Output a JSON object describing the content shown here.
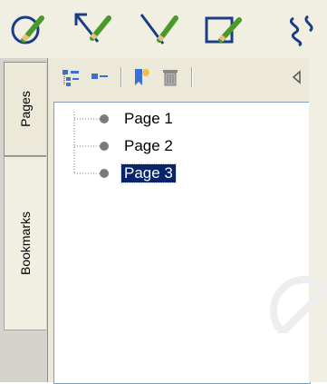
{
  "toolbar": {
    "tools": [
      {
        "icon": "ellipse-pencil-icon"
      },
      {
        "icon": "arrow-pencil-icon"
      },
      {
        "icon": "line-pencil-icon"
      },
      {
        "icon": "rectangle-pencil-icon"
      },
      {
        "icon": "freehand-pencil-icon"
      }
    ]
  },
  "side_tabs": [
    {
      "label": "Pages",
      "active": true
    },
    {
      "label": "Bookmarks",
      "active": false
    }
  ],
  "panel_toolbar": {
    "buttons": [
      "expand-all-icon",
      "collapse-all-icon",
      "new-bookmark-icon",
      "delete-icon",
      "collapse-panel-icon"
    ]
  },
  "pages": [
    {
      "label": "Page 1",
      "selected": false
    },
    {
      "label": "Page 2",
      "selected": false
    },
    {
      "label": "Page 3",
      "selected": true
    }
  ],
  "colors": {
    "selection": "#0a246a",
    "toolbar_bg": "#f1efe2",
    "panel_bg": "#ece9d8",
    "pencil": "#4a9a2a",
    "icon_blue": "#1a3d86"
  }
}
